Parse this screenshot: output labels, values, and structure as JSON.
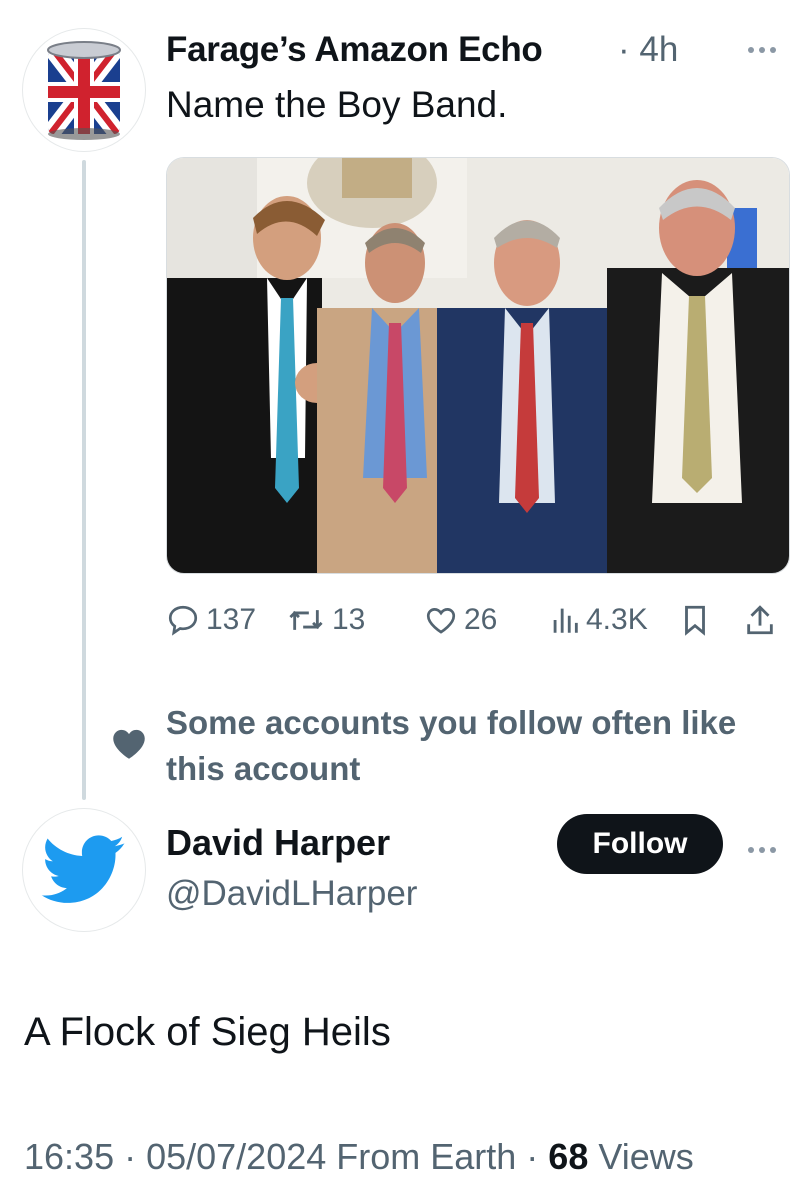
{
  "tweet": {
    "author_name": "Farage’s Amazon Echo",
    "time": "· 4h",
    "text": "Name the Boy Band.",
    "stats": {
      "replies": "137",
      "retweets": "13",
      "likes": "26",
      "views": "4.3K"
    }
  },
  "social_context": {
    "text": "Some accounts you follow often like this account"
  },
  "suggested_account": {
    "name": "David Harper",
    "handle": "@DavidLHarper",
    "follow_label": "Follow"
  },
  "reply": {
    "text": "A Flock of Sieg Heils",
    "meta_prefix": "16:35 · 05/07/2024 From Earth · ",
    "views_count": "68",
    "views_label": " Views"
  },
  "colors": {
    "primary_text": "#0f1419",
    "secondary_text": "#536471",
    "twitter_blue": "#1d9bf0",
    "thread_line": "#cfd9de"
  },
  "icons": [
    "union-jack-tin-avatar",
    "more-icon",
    "reply-icon",
    "retweet-icon",
    "like-icon",
    "views-icon",
    "bookmark-icon",
    "share-icon",
    "heart-icon",
    "twitter-bird-icon"
  ]
}
